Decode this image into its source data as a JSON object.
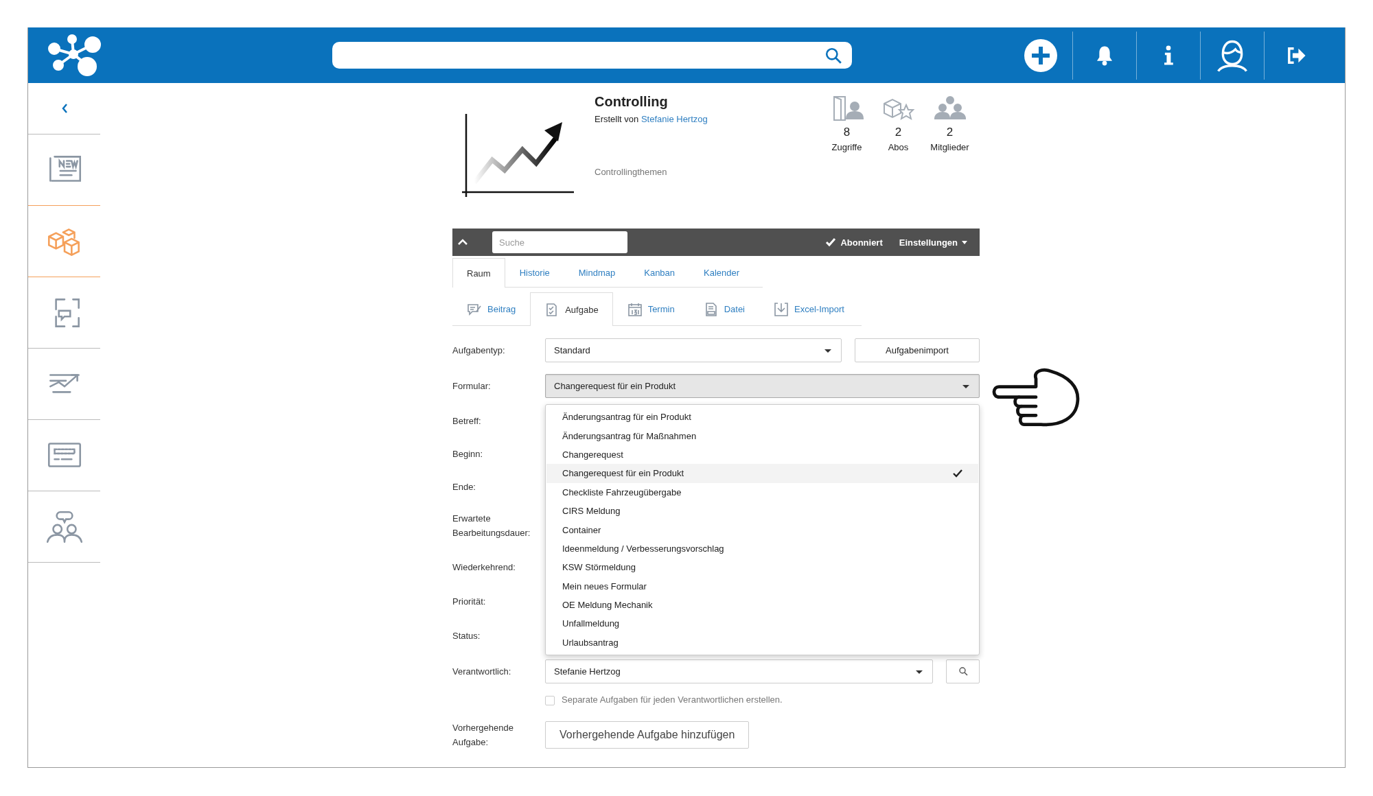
{
  "sidebar": {
    "items": [
      {
        "kind": "news",
        "selected": false
      },
      {
        "kind": "boxes",
        "selected": true
      },
      {
        "kind": "chat",
        "selected": false
      },
      {
        "kind": "chart",
        "selected": false
      },
      {
        "kind": "form",
        "selected": false
      },
      {
        "kind": "people",
        "selected": false
      }
    ]
  },
  "room": {
    "title": "Controlling",
    "byline": "Erstellt von",
    "author": "Stefanie Hertzog",
    "description": "Controllingthemen",
    "stats": [
      {
        "kind": "visits",
        "value": "8",
        "label": "Zugriffe"
      },
      {
        "kind": "subscriptions",
        "value": "2",
        "label": "Abos"
      },
      {
        "kind": "members",
        "value": "2",
        "label": "Mitglieder"
      }
    ]
  },
  "toolbar": {
    "search": {
      "placeholder": "Suche"
    },
    "subscribed": true,
    "subscribed_label": "Abonniert",
    "settings": "Einstellungen"
  },
  "tabs": [
    {
      "label": "Raum",
      "selected": true
    },
    {
      "label": "Historie",
      "selected": false
    },
    {
      "label": "Mindmap",
      "selected": false
    },
    {
      "label": "Kanban",
      "selected": false
    },
    {
      "label": "Kalender",
      "selected": false
    }
  ],
  "create_tabs": [
    {
      "kind": "post",
      "label": "Beitrag",
      "selected": false
    },
    {
      "kind": "task",
      "label": "Aufgabe",
      "selected": true
    },
    {
      "kind": "event",
      "label": "Termin",
      "selected": false
    },
    {
      "kind": "file",
      "label": "Datei",
      "selected": false
    },
    {
      "kind": "import",
      "label": "Excel-Import",
      "selected": false
    }
  ],
  "form": {
    "task_type": {
      "label": "Aufgabentyp:",
      "value": "Standard"
    },
    "import_button": "Aufgabenimport",
    "form_select": {
      "label": "Formular:",
      "value": "Changerequest für ein Produkt",
      "expanded": true,
      "options": [
        {
          "label": "Änderungsantrag für ein Produkt",
          "selected": false
        },
        {
          "label": "Änderungsantrag für Maßnahmen",
          "selected": false
        },
        {
          "label": "Changerequest",
          "selected": false
        },
        {
          "label": "Changerequest für ein Produkt",
          "selected": true
        },
        {
          "label": "Checkliste Fahrzeugübergabe",
          "selected": false
        },
        {
          "label": "CIRS Meldung",
          "selected": false
        },
        {
          "label": "Container",
          "selected": false
        },
        {
          "label": "Ideenmeldung / Verbesserungsvorschlag",
          "selected": false
        },
        {
          "label": "KSW Störmeldung",
          "selected": false
        },
        {
          "label": "Mein neues Formular",
          "selected": false
        },
        {
          "label": "OE Meldung Mechanik",
          "selected": false
        },
        {
          "label": "Unfallmeldung",
          "selected": false
        },
        {
          "label": "Urlaubsantrag",
          "selected": false
        }
      ]
    },
    "covered_rows": [
      "Betreff:",
      "Beginn:",
      "Ende:",
      "Erwartete Bearbeitungsdauer:",
      "Wiederkehrend:",
      "Priorität:",
      "Status:"
    ],
    "responsible": {
      "label": "Verantwortlich:",
      "value": "Stefanie Hertzog"
    },
    "separate": {
      "label": "Separate Aufgaben für jeden Verantwortlichen erstellen.",
      "checked": false
    },
    "previous": {
      "label": "Vorhergehende Aufgabe:",
      "button": "Vorhergehende Aufgabe hinzufügen"
    }
  }
}
